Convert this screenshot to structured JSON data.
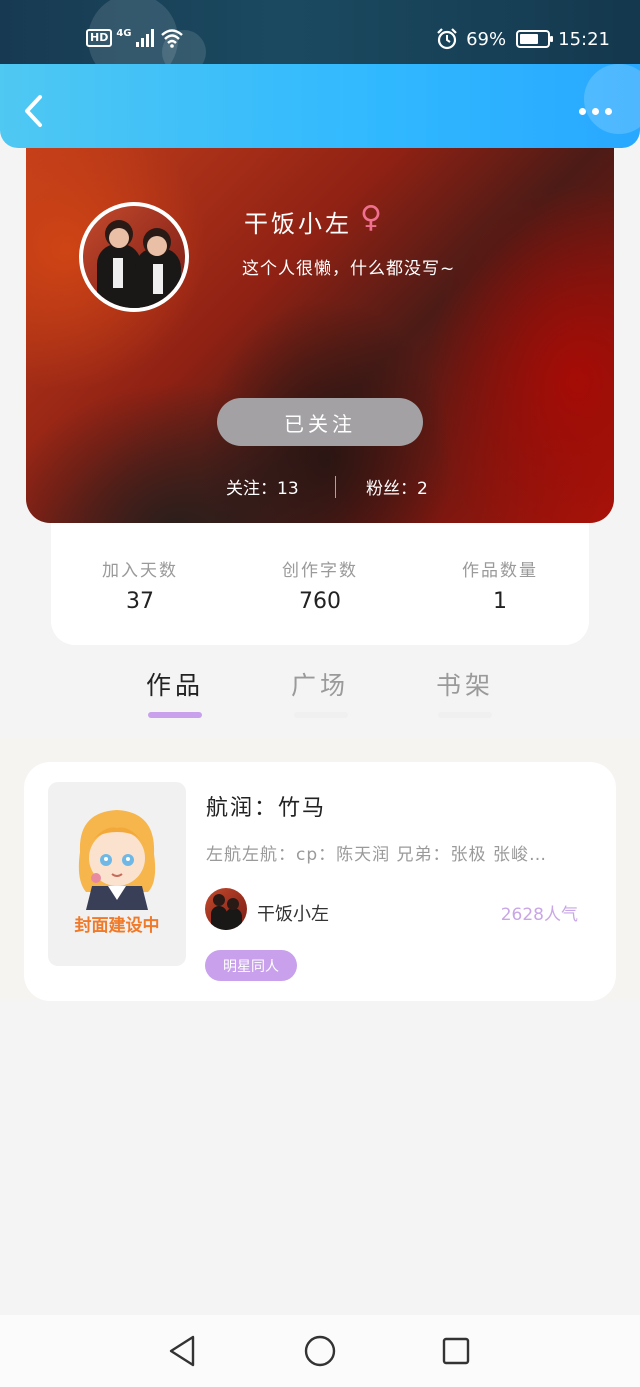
{
  "status_bar": {
    "network_hd": "HD",
    "network_gen": "4G",
    "battery_text": "69%",
    "battery_level": 0.69,
    "time": "15:21"
  },
  "profile": {
    "nickname": "干饭小左",
    "gender_symbol": "♀",
    "signature": "这个人很懒，什么都没写~",
    "follow_button": "已关注",
    "following_label": "关注：",
    "following_count": "13",
    "fans_label": "粉丝：",
    "fans_count": "2"
  },
  "stats": [
    {
      "label": "加入天数",
      "value": "37"
    },
    {
      "label": "创作字数",
      "value": "760"
    },
    {
      "label": "作品数量",
      "value": "1"
    }
  ],
  "tabs": [
    {
      "label": "作品",
      "active": true
    },
    {
      "label": "广场",
      "active": false
    },
    {
      "label": "书架",
      "active": false
    }
  ],
  "works": [
    {
      "cover_text": "封面建设中",
      "title": "航润：竹马",
      "description": "左航左航：cp：陈天润 兄弟：张极 张峻…",
      "author": "干饭小左",
      "popularity": "2628人气",
      "tag": "明星同人"
    }
  ],
  "colors": {
    "header_blue": "#30b8ff",
    "tab_active_underline": "#c8a0ec",
    "tag_purple": "#c8a0ec",
    "gender_pink": "#f07090",
    "cover_text_orange": "#f07a2a"
  },
  "icons": {
    "back": "back-arrow-icon",
    "more": "more-dots-icon",
    "alarm": "alarm-icon",
    "wifi": "wifi-icon",
    "signal": "signal-icon",
    "battery": "battery-icon",
    "nav_back": "nav-back-triangle-icon",
    "nav_home": "nav-home-circle-icon",
    "nav_recents": "nav-recents-square-icon"
  }
}
